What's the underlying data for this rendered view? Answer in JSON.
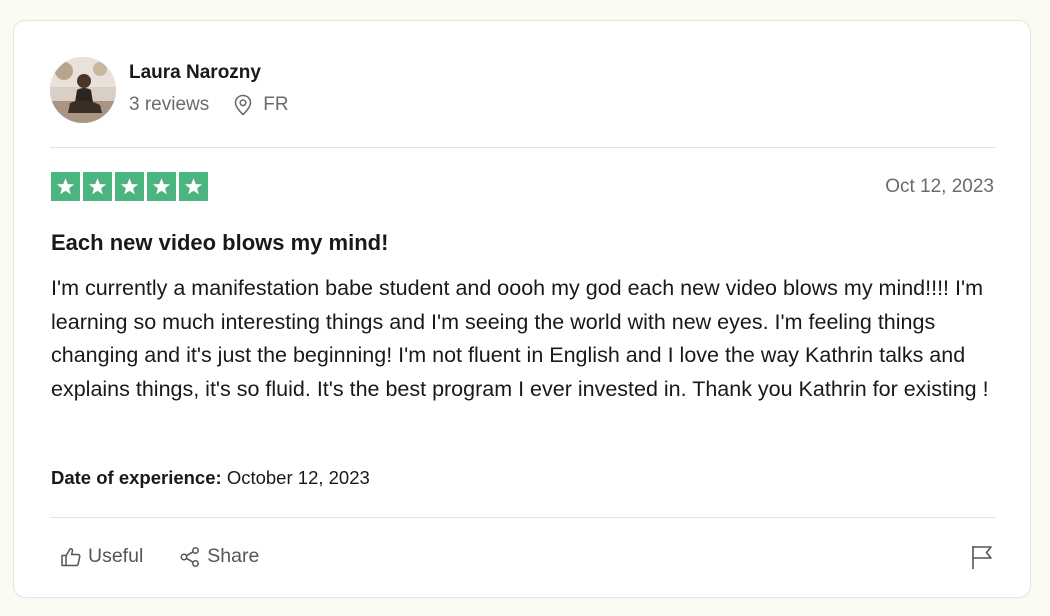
{
  "reviewer": {
    "name": "Laura Narozny",
    "reviews_count": "3 reviews",
    "location": "FR"
  },
  "review": {
    "rating": 5,
    "rating_max": 5,
    "star_color": "#4cb47f",
    "date": "Oct 12, 2023",
    "title": "Each new video blows my mind!",
    "body": "I'm currently a manifestation babe student and oooh my god each new video blows my mind!!!! I'm learning so much interesting things and I'm seeing the world with new eyes. I'm feeling things changing and it's just the beginning! I'm not fluent in English and I love the way Kathrin talks and explains things, it's so fluid. It's the best program I ever invested in. Thank you Kathrin for existing !",
    "experience_label": "Date of experience:",
    "experience_date": "October 12, 2023"
  },
  "actions": {
    "useful_label": "Useful",
    "share_label": "Share"
  },
  "icons": {
    "location": "location-pin-icon",
    "useful": "thumbs-up-icon",
    "share": "share-icon",
    "report": "flag-icon",
    "star": "star-icon"
  }
}
